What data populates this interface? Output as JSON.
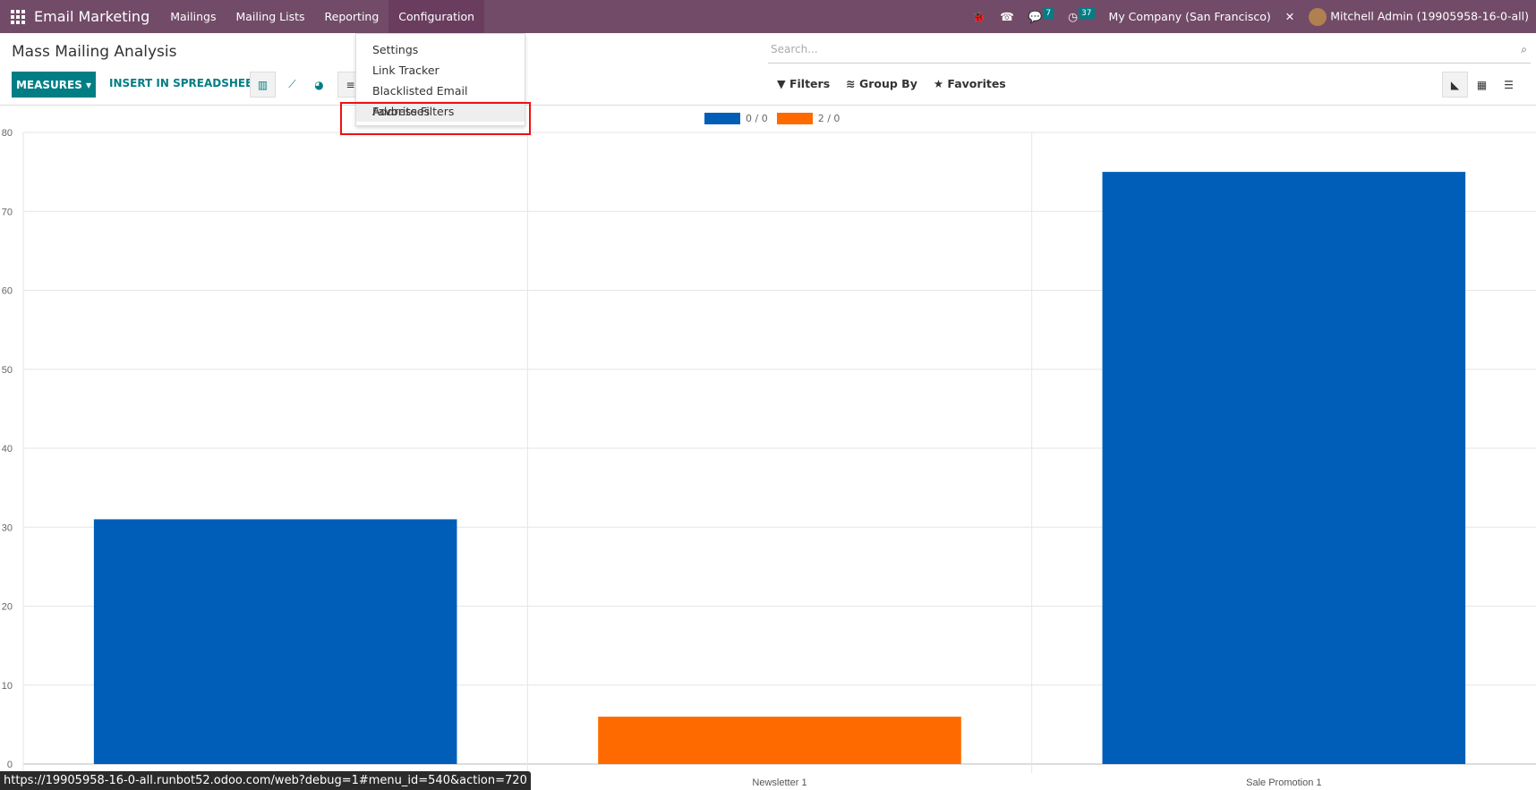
{
  "topbar": {
    "app": "Email Marketing",
    "menus": [
      "Mailings",
      "Mailing Lists",
      "Reporting",
      "Configuration"
    ],
    "messages_count": "7",
    "activities_count": "37",
    "company": "My Company (San Francisco)",
    "user": "Mitchell Admin (19905958-16-0-all)"
  },
  "page": {
    "title": "Mass Mailing Analysis",
    "measures": "MEASURES",
    "insert": "INSERT IN SPREADSHEET"
  },
  "search": {
    "placeholder": "Search...",
    "filters": "Filters",
    "group_by": "Group By",
    "favorites": "Favorites"
  },
  "config_menu": {
    "items": [
      "Settings",
      "Link Tracker",
      "Blacklisted Email Addresses",
      "Favorite Filters"
    ],
    "highlighted": "Favorite Filters"
  },
  "status_url": "https://19905958-16-0-all.runbot52.odoo.com/web?debug=1#menu_id=540&action=720",
  "chart_data": {
    "type": "bar",
    "categories": [
      "",
      "Newsletter 1",
      "Sale Promotion 1"
    ],
    "series": [
      {
        "name": "0 / 0",
        "color": "#005eb8",
        "values": [
          31,
          null,
          75
        ]
      },
      {
        "name": "2 / 0",
        "color": "#ff6a00",
        "values": [
          null,
          6,
          null
        ]
      }
    ],
    "ylim": [
      0,
      80
    ],
    "yticks": [
      0,
      10,
      20,
      30,
      40,
      50,
      60,
      70,
      80
    ],
    "grid": true,
    "legend": "top-center"
  }
}
